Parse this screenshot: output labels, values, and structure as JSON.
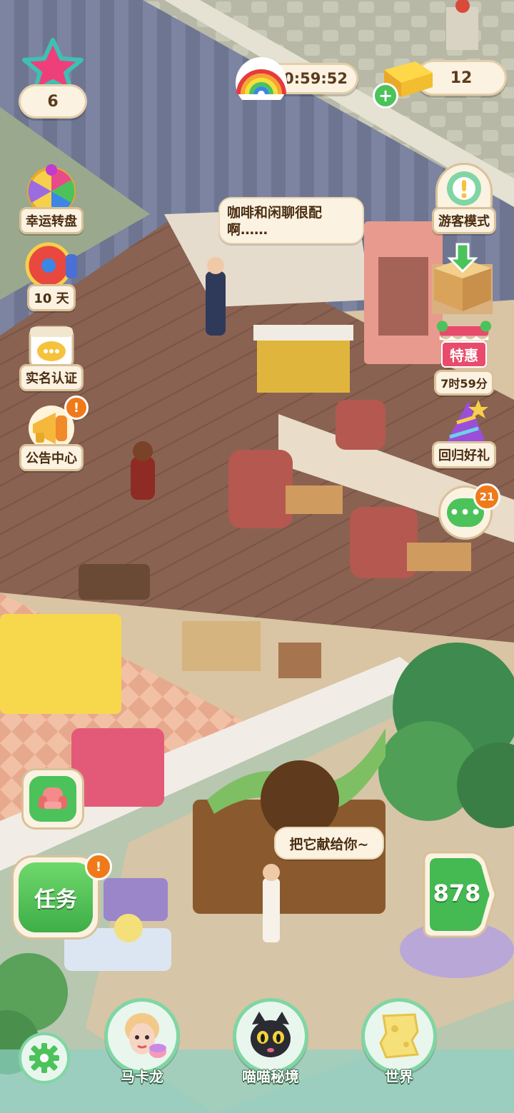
{
  "hud": {
    "star_count": "6",
    "timer": "0:59:52",
    "gold_count": "12"
  },
  "left_menu": [
    {
      "label": "幸运转盘",
      "icon": "lucky-wheel-icon"
    },
    {
      "label": "10 天",
      "icon": "ferris-wheel-icon"
    },
    {
      "label": "实名认证",
      "icon": "calendar-chat-icon"
    },
    {
      "label": "公告中心",
      "icon": "megaphone-icon"
    }
  ],
  "right_menu": [
    {
      "label": "游客模式",
      "icon": "visitor-alert-icon"
    },
    {
      "label": "特惠",
      "sublabel": "7时59分",
      "icon": "shop-stall-icon"
    },
    {
      "label": "回归好礼",
      "icon": "party-hat-icon"
    }
  ],
  "chat": {
    "badge_count": "21"
  },
  "dialogs": {
    "top": "咖啡和闲聊很配啊……",
    "bottom": "把它献给你~"
  },
  "tasks": {
    "label": "任务"
  },
  "energy": {
    "value": "878"
  },
  "bottom_nav": [
    {
      "label": "马卡龙",
      "icon": "macaron-girl-avatar"
    },
    {
      "label": "喵喵秘境",
      "icon": "black-cat-avatar"
    },
    {
      "label": "世界",
      "icon": "world-map-icon"
    }
  ],
  "colors": {
    "accent_green": "#4cc25b",
    "badge_orange": "#f07a1a",
    "pill_bg": "#fbf2e1"
  }
}
